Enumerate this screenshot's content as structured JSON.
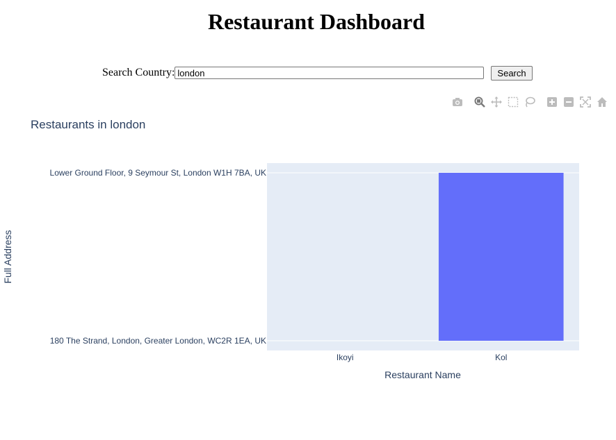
{
  "header": {
    "title": "Restaurant Dashboard"
  },
  "search": {
    "label": "Search Country:",
    "value": "london",
    "button_label": "Search"
  },
  "modebar": {
    "icons": [
      "camera-icon",
      "zoom-icon",
      "pan-icon",
      "box-select-icon",
      "lasso-icon",
      "zoom-in-icon",
      "zoom-out-icon",
      "autoscale-icon",
      "reset-axes-icon"
    ],
    "color": "#bcbcbc",
    "active_color": "#7a7a7a"
  },
  "chart_data": {
    "type": "bar",
    "title": "Restaurants in london",
    "xlabel": "Restaurant Name",
    "ylabel": "Full Address",
    "categories": [
      "Ikoyi",
      "Kol"
    ],
    "y_categories": [
      "180 The Strand, London, Greater London, WC2R 1EA, UK",
      "Lower Ground Floor, 9 Seymour St, London W1H 7BA, UK"
    ],
    "values": [
      "180 The Strand, London, Greater London, WC2R 1EA, UK",
      "Lower Ground Floor, 9 Seymour St, London W1H 7BA, UK"
    ],
    "bar_color": "#636efa",
    "plot_bg": "#e5ecf6",
    "grid": true
  }
}
